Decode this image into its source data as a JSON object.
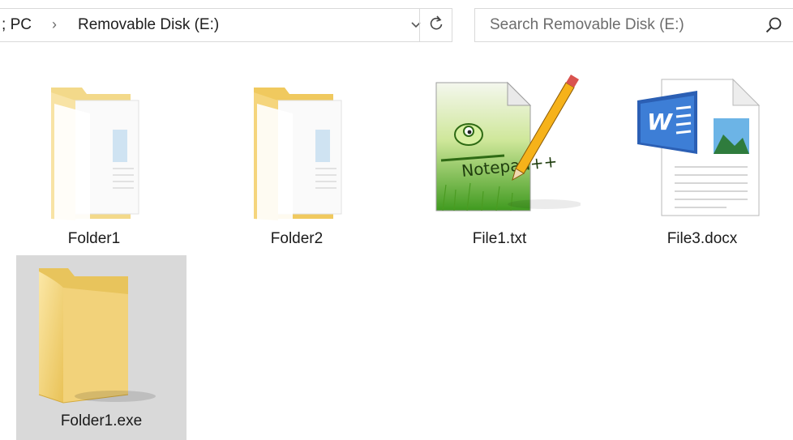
{
  "address_bar": {
    "crumb_this_pc": "PC",
    "crumb_prefix": ";",
    "separator": "›",
    "current_location": "Removable Disk (E:)",
    "dropdown_glyph": "⌄",
    "refresh_glyph": "↻"
  },
  "search": {
    "placeholder": "Search Removable Disk (E:)",
    "icon": "search-icon"
  },
  "items": [
    {
      "name": "Folder1",
      "type": "folder",
      "icon": "folder-with-documents-icon"
    },
    {
      "name": "Folder2",
      "type": "folder",
      "icon": "folder-with-documents-icon"
    },
    {
      "name": "File1.txt",
      "type": "text-file",
      "icon": "notepad-plus-plus-file-icon"
    },
    {
      "name": "File3.docx",
      "type": "word-document",
      "icon": "word-document-icon"
    },
    {
      "name": "Folder1.exe",
      "type": "executable",
      "icon": "folder-icon",
      "selected": true
    }
  ],
  "colors": {
    "selection": "#d9d9d9",
    "folder": "#f7d77a",
    "border": "#d9d9d9"
  }
}
